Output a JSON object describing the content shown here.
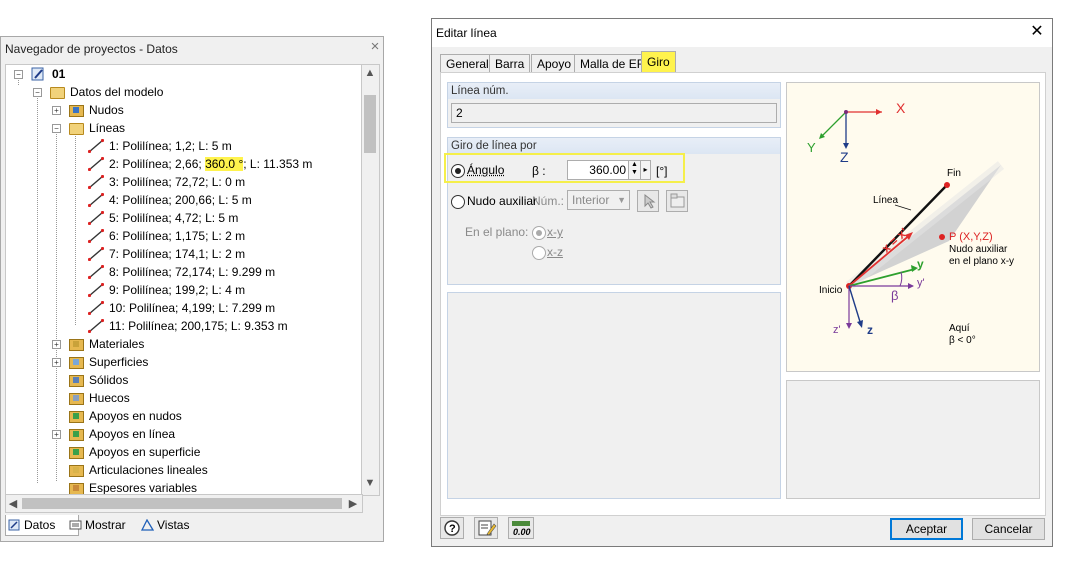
{
  "navigator": {
    "title": "Navegador de proyectos - Datos",
    "close": "×",
    "tree": {
      "root": "01",
      "model_data": "Datos del modelo",
      "nodes": "Nudos",
      "lines": "Líneas",
      "line_items": [
        {
          "pre": "1: Polilínea; 1,2; L: 5 m",
          "hl": "",
          "post": ""
        },
        {
          "pre": "2: Polilínea; 2,66; ",
          "hl": "360.0 °",
          "post": "; L: 11.353 m"
        },
        {
          "pre": "3: Polilínea; 72,72; L: 0 m",
          "hl": "",
          "post": ""
        },
        {
          "pre": "4: Polilínea; 200,66; L: 5 m",
          "hl": "",
          "post": ""
        },
        {
          "pre": "5: Polilínea; 4,72; L: 5 m",
          "hl": "",
          "post": ""
        },
        {
          "pre": "6: Polilínea; 1,175; L: 2 m",
          "hl": "",
          "post": ""
        },
        {
          "pre": "7: Polilínea; 174,1; L: 2 m",
          "hl": "",
          "post": ""
        },
        {
          "pre": "8: Polilínea; 72,174; L: 9.299 m",
          "hl": "",
          "post": ""
        },
        {
          "pre": "9: Polilínea; 199,2; L: 4 m",
          "hl": "",
          "post": ""
        },
        {
          "pre": "10: Polilínea; 4,199; L: 7.299 m",
          "hl": "",
          "post": ""
        },
        {
          "pre": "11: Polilínea; 200,175; L: 9.353 m",
          "hl": "",
          "post": ""
        }
      ],
      "after_items": [
        {
          "label": "Materiales",
          "expander": true
        },
        {
          "label": "Superficies",
          "expander": true
        },
        {
          "label": "Sólidos",
          "expander": false
        },
        {
          "label": "Huecos",
          "expander": false
        },
        {
          "label": "Apoyos en nudos",
          "expander": false
        },
        {
          "label": "Apoyos en línea",
          "expander": true
        },
        {
          "label": "Apoyos en superficie",
          "expander": false
        },
        {
          "label": "Articulaciones lineales",
          "expander": false
        },
        {
          "label": "Espesores variables",
          "expander": false
        }
      ]
    },
    "tabs": [
      "Datos",
      "Mostrar",
      "Vistas"
    ]
  },
  "dialog": {
    "title": "Editar línea",
    "close": "✕",
    "tabs": [
      "General",
      "Barra",
      "Apoyo",
      "Malla de EF",
      "Giro"
    ],
    "active_tab": "Giro",
    "line_no": {
      "label": "Línea núm.",
      "value": "2"
    },
    "rotation": {
      "label": "Giro de línea por",
      "angle_option": "Ángulo",
      "beta_label": "β :",
      "beta_value": "360.00",
      "beta_unit": "[°]",
      "aux_node_option": "Nudo auxiliar",
      "num_label": "Núm.:",
      "num_select": "Interior",
      "plane_label": "En el plano:",
      "plane_xy": "x-y",
      "plane_xz": "x-z"
    },
    "diagram": {
      "x": "X",
      "y": "Y",
      "z": "Z",
      "fin": "Fin",
      "linea": "Línea",
      "inicio": "Inicio",
      "p_label": "P (X,Y,Z)",
      "aux_node_1": "Nudo auxiliar",
      "aux_node_2": "en el plano x-y",
      "local_x": "x = x'",
      "local_y": "y",
      "local_yp": "y'",
      "local_z": "z",
      "local_zp": "z'",
      "beta": "β",
      "here_1": "Aquí",
      "here_2": "β < 0°"
    },
    "buttons": {
      "accept": "Aceptar",
      "cancel": "Cancelar"
    },
    "footer_icons": [
      "help-icon",
      "edit-icon",
      "calc-icon"
    ],
    "colors": {
      "highlight": "#fff34d",
      "axis_red": "#e03030",
      "axis_green": "#2ea02e",
      "axis_blue": "#1f3c88"
    }
  }
}
